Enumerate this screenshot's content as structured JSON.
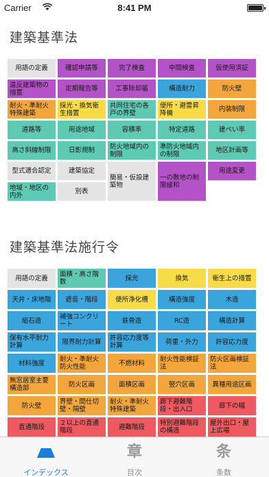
{
  "status_bar": {
    "carrier": "Carrier",
    "time": "8:41 PM"
  },
  "sections": [
    {
      "title": "建築基準法",
      "tiles": [
        {
          "label": "用語の定義",
          "color": "gray",
          "align": "center"
        },
        {
          "label": "確認申請等",
          "color": "purple",
          "align": "center"
        },
        {
          "label": "完了検査",
          "color": "purple",
          "align": "center"
        },
        {
          "label": "中間検査",
          "color": "purple",
          "align": "center"
        },
        {
          "label": "仮使用済証",
          "color": "purple",
          "align": "center"
        },
        {
          "label": "違反建築物の措置",
          "color": "purple",
          "align": "left"
        },
        {
          "label": "定期報告等",
          "color": "purple",
          "align": "center"
        },
        {
          "label": "工事除却届",
          "color": "purple",
          "align": "center"
        },
        {
          "label": "構造耐力",
          "color": "blue",
          "align": "center"
        },
        {
          "label": "防火壁",
          "color": "orange",
          "align": "center"
        },
        {
          "label": "耐火・準耐火特殊建築",
          "color": "orange",
          "align": "left"
        },
        {
          "label": "採光・換気衛生措置",
          "color": "yellow",
          "align": "left"
        },
        {
          "label": "共同住宅の各戸の界壁",
          "color": "teal",
          "align": "left"
        },
        {
          "label": "便所・避雷昇降機",
          "color": "yellow",
          "align": "left"
        },
        {
          "label": "内装制限",
          "color": "orange",
          "align": "center"
        },
        {
          "label": "道路等",
          "color": "teal",
          "align": "center"
        },
        {
          "label": "用途地域",
          "color": "teal",
          "align": "center"
        },
        {
          "label": "容積率",
          "color": "teal",
          "align": "center"
        },
        {
          "label": "特定道路",
          "color": "teal",
          "align": "center"
        },
        {
          "label": "建ぺい率",
          "color": "teal",
          "align": "center"
        },
        {
          "label": "高さ斜線制限",
          "color": "teal",
          "align": "center"
        },
        {
          "label": "日影規制",
          "color": "teal",
          "align": "center"
        },
        {
          "label": "防火地域内の制限",
          "color": "teal",
          "align": "left"
        },
        {
          "label": "準防火地域内の制限",
          "color": "teal",
          "align": "left"
        },
        {
          "label": "地区計画等",
          "color": "teal",
          "align": "center"
        },
        {
          "label": "型式適合認定",
          "color": "gray",
          "align": "center"
        },
        {
          "label": "建築協定",
          "color": "gray",
          "align": "center"
        },
        {
          "label": "簡易・仮設建築物",
          "color": "gray",
          "align": "left",
          "tall": true
        },
        {
          "label": "一の敷地の制限緩和",
          "color": "purple",
          "align": "left",
          "tall": true
        },
        {
          "label": "用途変更",
          "color": "purple",
          "align": "center"
        },
        {
          "label": "地域・地区の内外",
          "color": "teal",
          "align": "left"
        },
        {
          "label": "別表",
          "color": "gray",
          "align": "center"
        }
      ]
    },
    {
      "title": "建築基準法施行令",
      "tiles": [
        {
          "label": "用語の定義",
          "color": "gray",
          "align": "center"
        },
        {
          "label": "面積・高さ階数",
          "color": "teal",
          "align": "left"
        },
        {
          "label": "採光",
          "color": "blue",
          "align": "center"
        },
        {
          "label": "換気",
          "color": "yellow",
          "align": "center"
        },
        {
          "label": "衛生上の措置",
          "color": "yellow",
          "align": "center"
        },
        {
          "label": "天井・床地階",
          "color": "blue",
          "align": "center"
        },
        {
          "label": "遮音・階段",
          "color": "blue",
          "align": "center"
        },
        {
          "label": "便所浄化槽",
          "color": "yellow",
          "align": "center"
        },
        {
          "label": "構造強度",
          "color": "blue",
          "align": "center"
        },
        {
          "label": "木造",
          "color": "blue",
          "align": "center"
        },
        {
          "label": "組石造",
          "color": "blue",
          "align": "center"
        },
        {
          "label": "補強コンクリート",
          "color": "blue",
          "align": "left"
        },
        {
          "label": "鉄骨造",
          "color": "blue",
          "align": "center"
        },
        {
          "label": "RC造",
          "color": "blue",
          "align": "center"
        },
        {
          "label": "構造計算",
          "color": "blue",
          "align": "center"
        },
        {
          "label": "保有水平耐力計算",
          "color": "blue",
          "align": "left"
        },
        {
          "label": "限界耐力計算",
          "color": "blue",
          "align": "center"
        },
        {
          "label": "許容応力度等計算",
          "color": "blue",
          "align": "left"
        },
        {
          "label": "荷重・外力",
          "color": "blue",
          "align": "center"
        },
        {
          "label": "許容応力度",
          "color": "blue",
          "align": "center"
        },
        {
          "label": "材料強度",
          "color": "blue",
          "align": "center"
        },
        {
          "label": "耐火・準耐火防火性能",
          "color": "orange",
          "align": "left"
        },
        {
          "label": "不燃材料",
          "color": "orange",
          "align": "center"
        },
        {
          "label": "耐火性能検証法",
          "color": "orange",
          "align": "left"
        },
        {
          "label": "防火区画検証法",
          "color": "orange",
          "align": "left"
        },
        {
          "label": "無窓居室主要構造部",
          "color": "orange",
          "align": "left"
        },
        {
          "label": "防火区画",
          "color": "orange",
          "align": "center"
        },
        {
          "label": "面積区画",
          "color": "orange",
          "align": "center"
        },
        {
          "label": "竪穴区画",
          "color": "orange",
          "align": "center"
        },
        {
          "label": "異種用途区画",
          "color": "orange",
          "align": "center"
        },
        {
          "label": "防火壁",
          "color": "orange",
          "align": "center"
        },
        {
          "label": "界壁・間仕切壁・隔壁",
          "color": "orange",
          "align": "left"
        },
        {
          "label": "耐火・準耐火特殊建築",
          "color": "orange",
          "align": "left"
        },
        {
          "label": "廊下避難階段・出入口",
          "color": "red",
          "align": "left"
        },
        {
          "label": "廊下の幅",
          "color": "red",
          "align": "center"
        },
        {
          "label": "直通階段",
          "color": "red",
          "align": "center"
        },
        {
          "label": "２以上の直通階段",
          "color": "red",
          "align": "left"
        },
        {
          "label": "避難階段",
          "color": "red",
          "align": "center"
        },
        {
          "label": "特別避難階段の構造",
          "color": "red",
          "align": "left"
        },
        {
          "label": "屋外出口・屋上広場",
          "color": "red",
          "align": "left"
        }
      ]
    }
  ],
  "tab_bar": {
    "tabs": [
      {
        "label": "インデックス",
        "icon": "index-trapezoid-icon",
        "selected": true
      },
      {
        "label": "目次",
        "icon_text": "章",
        "icon": "chapter-icon",
        "selected": false
      },
      {
        "label": "条数",
        "icon_text": "条",
        "icon": "article-icon",
        "selected": false
      }
    ]
  },
  "colors": {
    "gray": "#e4e4e4",
    "purple": "#b452c7",
    "blue": "#3aa5dc",
    "teal": "#5ecab3",
    "orange": "#f2a63b",
    "yellow": "#f7dc47",
    "red": "#ee5a5f",
    "accent": "#1a7fd9"
  }
}
